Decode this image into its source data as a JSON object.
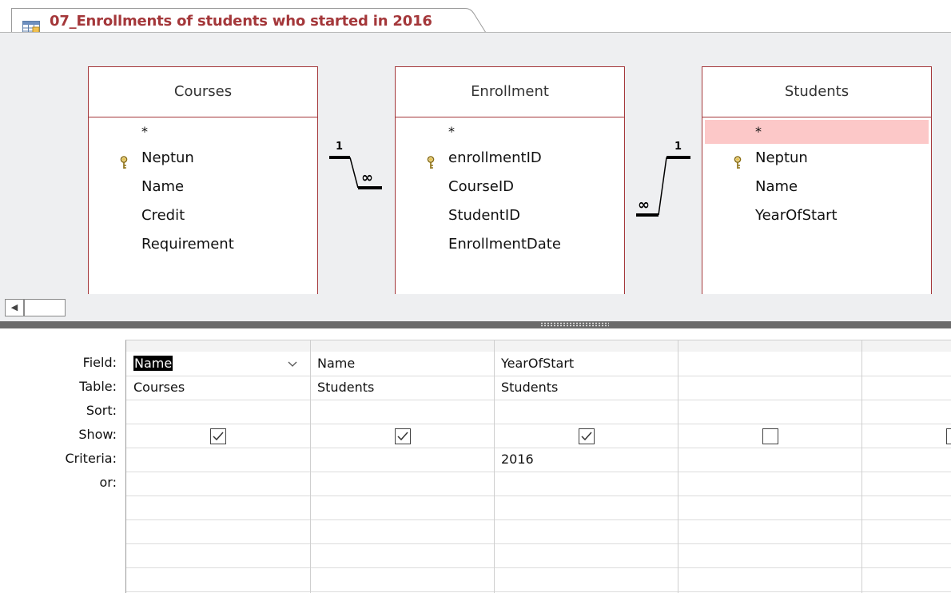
{
  "tab": {
    "title": "07_Enrollments of students who started in 2016",
    "icon": "query-icon"
  },
  "tables": [
    {
      "name": "Courses",
      "fields": [
        "*",
        "Neptun",
        "Name",
        "Credit",
        "Requirement"
      ],
      "key_field": "Neptun"
    },
    {
      "name": "Enrollment",
      "fields": [
        "*",
        "enrollmentID",
        "CourseID",
        "StudentID",
        "EnrollmentDate"
      ],
      "key_field": "enrollmentID"
    },
    {
      "name": "Students",
      "fields": [
        "*",
        "Neptun",
        "Name",
        "YearOfStart"
      ],
      "key_field": "Neptun",
      "highlighted_field": "*"
    }
  ],
  "relationships": [
    {
      "left_label": "1",
      "right_label": "∞"
    },
    {
      "left_label": "∞",
      "right_label": "1"
    }
  ],
  "scroll": {
    "left_arrow": "◀"
  },
  "grid": {
    "row_labels": [
      "Field:",
      "Table:",
      "Sort:",
      "Show:",
      "Criteria:",
      "or:"
    ],
    "columns": [
      {
        "field": "Name",
        "table": "Courses",
        "sort": "",
        "show": true,
        "criteria": "",
        "or": ""
      },
      {
        "field": "Name",
        "table": "Students",
        "sort": "",
        "show": true,
        "criteria": "",
        "or": ""
      },
      {
        "field": "YearOfStart",
        "table": "Students",
        "sort": "",
        "show": true,
        "criteria": "2016",
        "or": ""
      },
      {
        "field": "",
        "table": "",
        "sort": "",
        "show": false,
        "criteria": "",
        "or": ""
      },
      {
        "field": "",
        "table": "",
        "sort": "",
        "show": false,
        "criteria": "",
        "or": ""
      }
    ]
  },
  "colors": {
    "accent": "#a4373a",
    "highlight": "#fcc8c8",
    "diagram_bg": "#eeeff1"
  }
}
